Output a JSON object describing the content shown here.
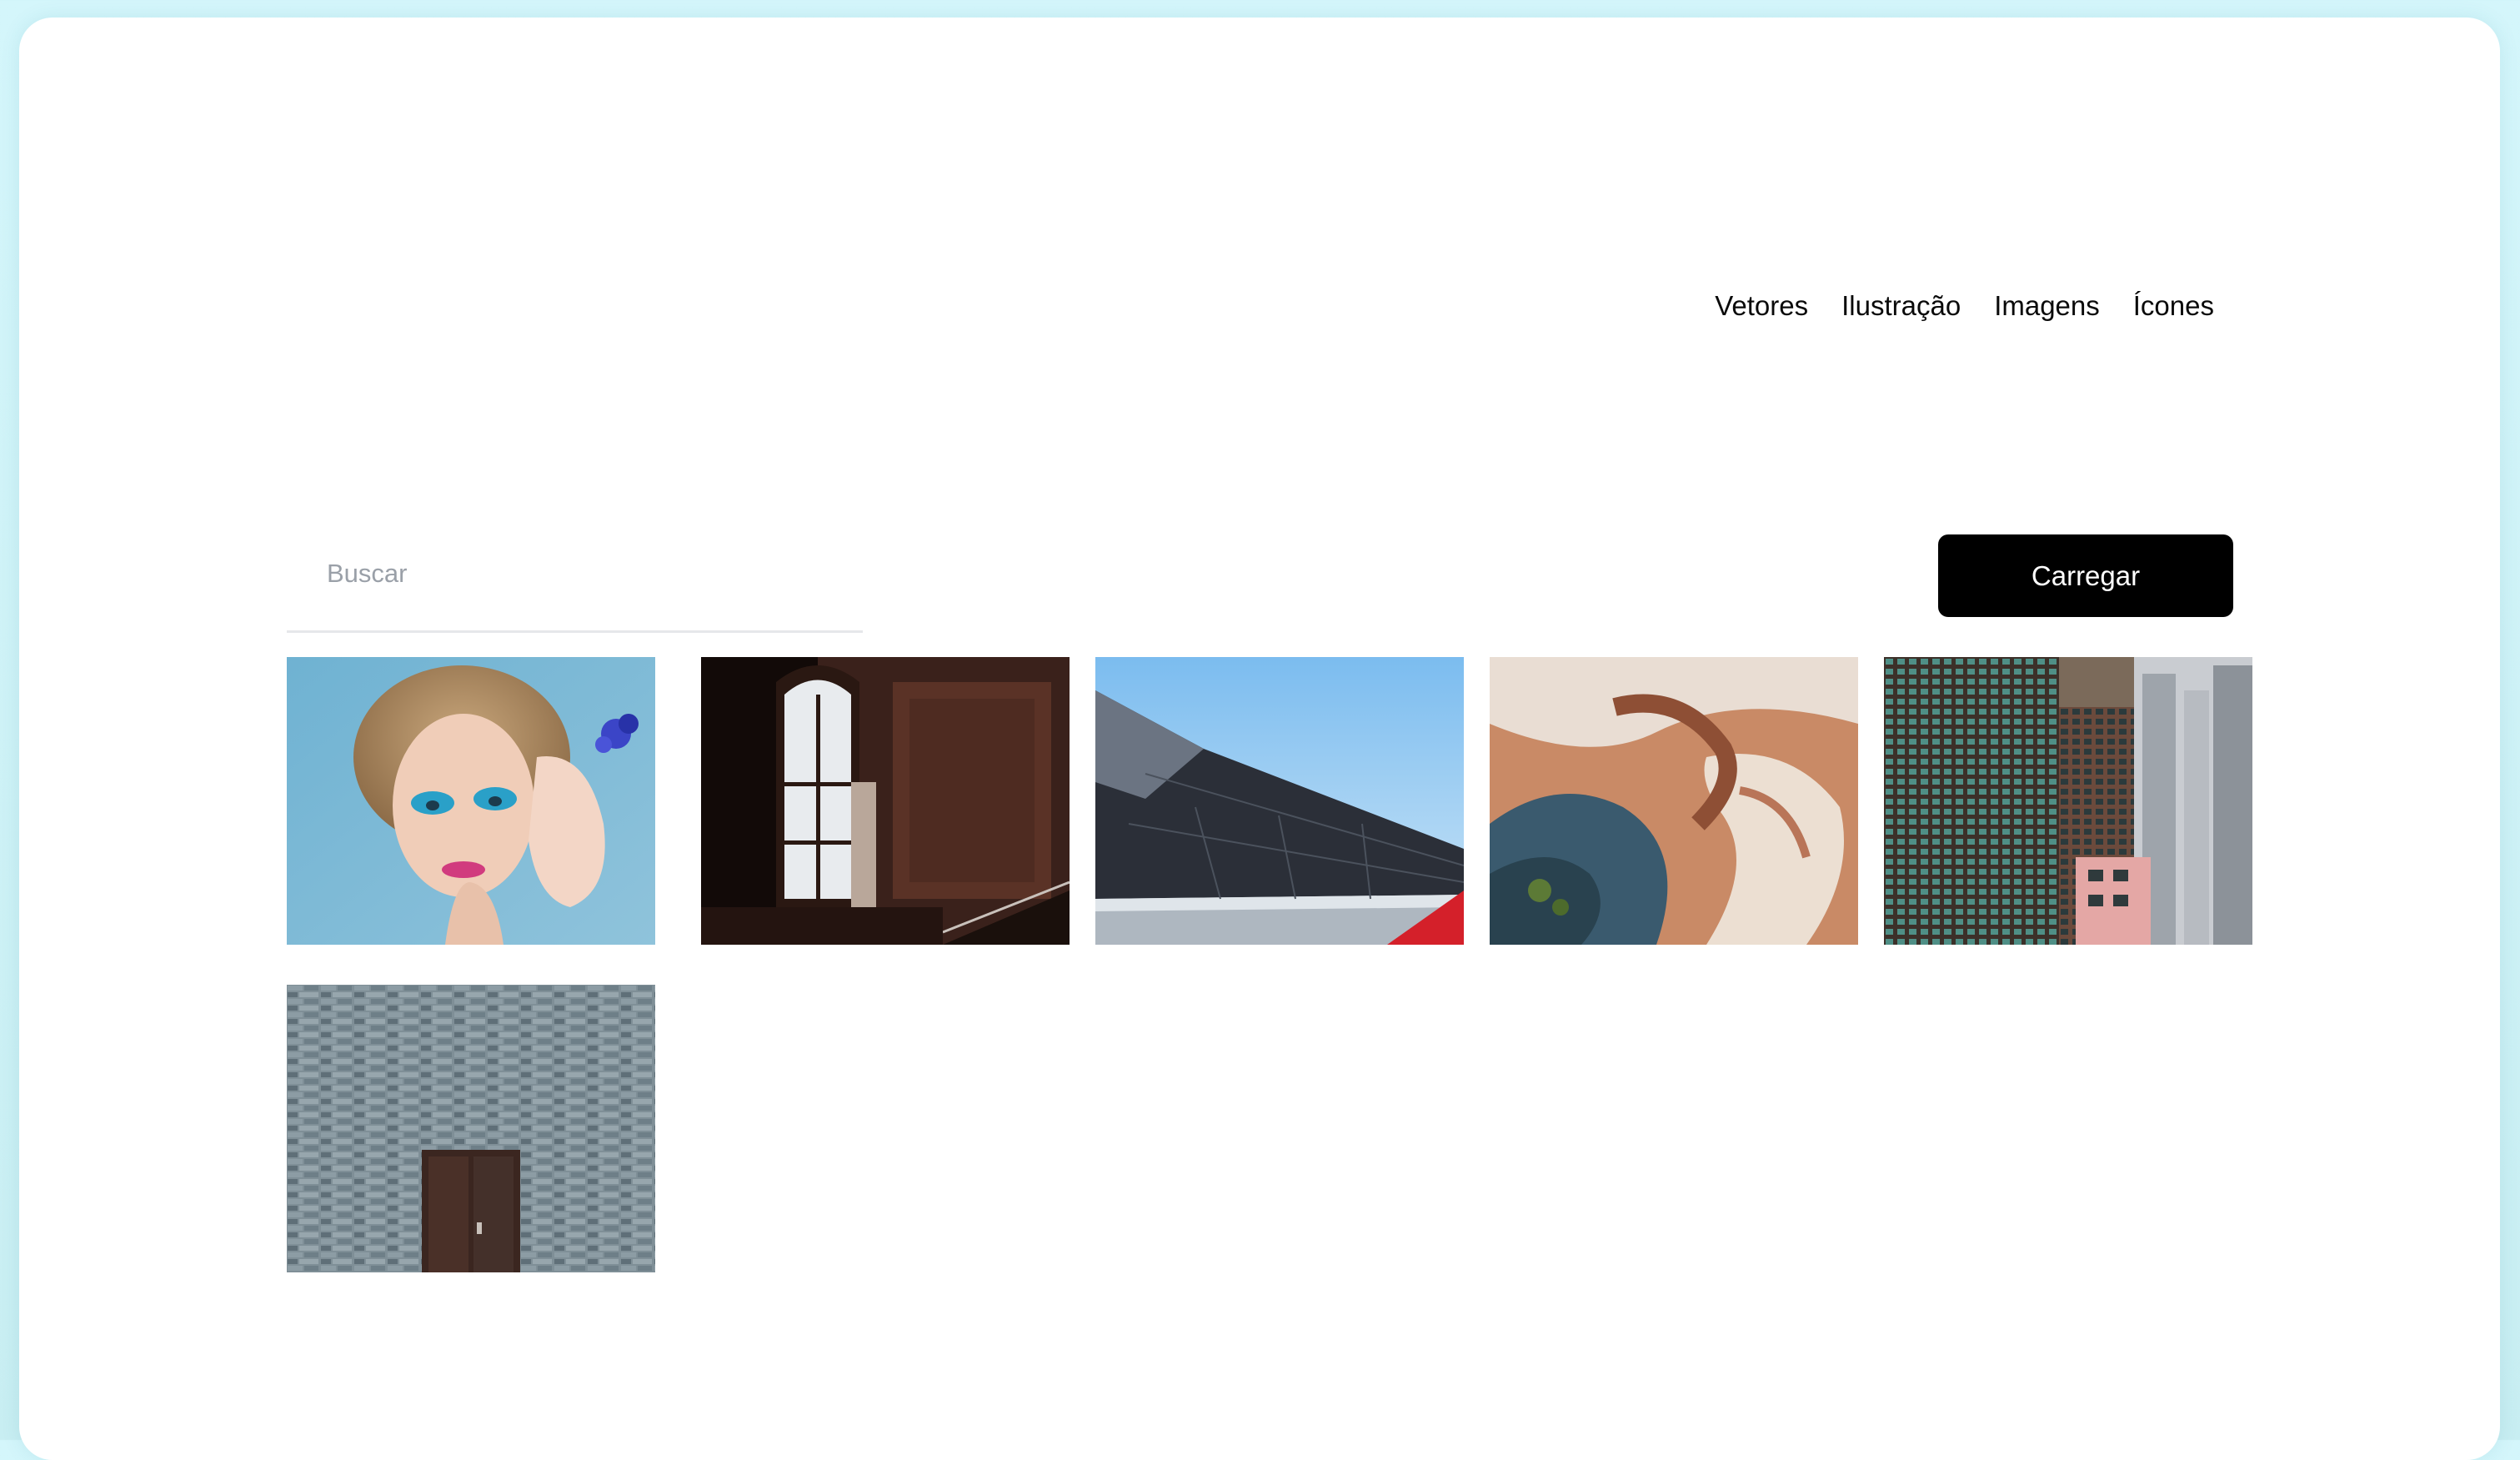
{
  "nav": {
    "items": [
      {
        "label": "Vetores"
      },
      {
        "label": "Ilustração"
      },
      {
        "label": "Imagens"
      },
      {
        "label": "Ícones"
      }
    ]
  },
  "search": {
    "placeholder": "Buscar",
    "value": ""
  },
  "toolbar": {
    "upload_label": "Carregar"
  },
  "gallery": {
    "images": [
      {
        "subject": "woman-blue-eyeshadow"
      },
      {
        "subject": "dark-room-arched-window"
      },
      {
        "subject": "dark-glass-roof-blue-sky"
      },
      {
        "subject": "aerial-sand-patterns"
      },
      {
        "subject": "city-residential-towers"
      },
      {
        "subject": "brick-wall-wooden-door"
      }
    ]
  },
  "colors": {
    "page_background": "#d4f6fb",
    "window_background": "#ffffff",
    "button_background": "#000000",
    "button_text": "#ffffff",
    "placeholder_text": "#9aa0a8",
    "divider": "#e6e7ea"
  }
}
